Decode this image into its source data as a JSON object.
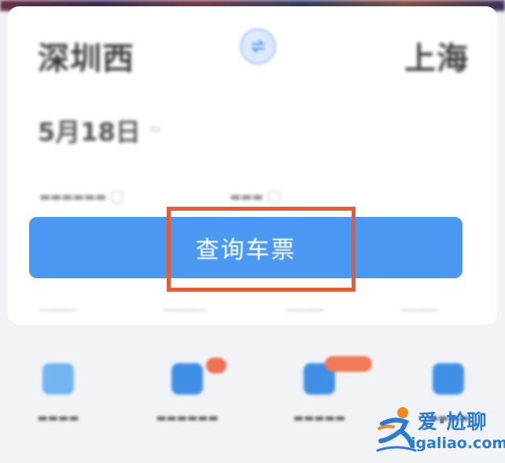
{
  "search": {
    "from_station": "深圳西",
    "to_station": "上海",
    "date": "5月18日",
    "query_button_label": "查询车票"
  },
  "highlight_color": "#ea5a32",
  "accent_color": "#4b98f2",
  "icons": {
    "swap": "swap-stations-icon",
    "services": [
      "station-map-icon",
      "ticket-icon",
      "ticket-icon",
      "download-icon"
    ]
  },
  "watermark": {
    "text": "爱·尬聊",
    "domain": "igaliao.com"
  }
}
